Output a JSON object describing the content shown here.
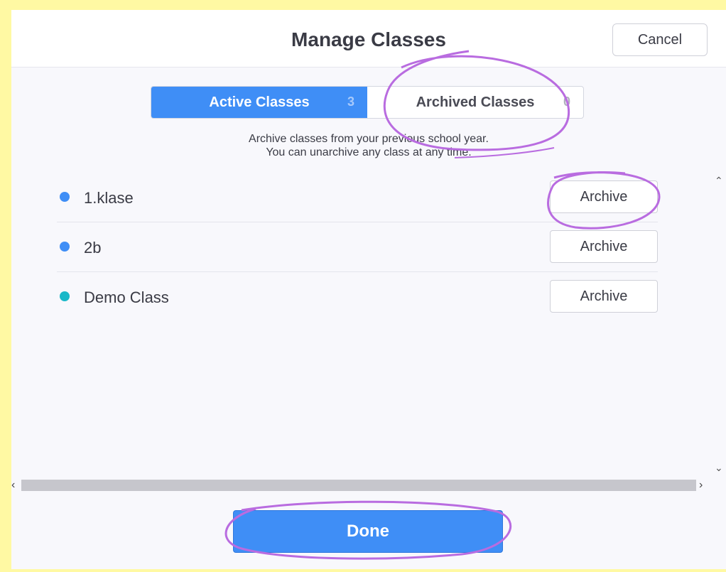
{
  "header": {
    "title": "Manage Classes",
    "cancel_label": "Cancel"
  },
  "tabs": [
    {
      "label": "Active Classes",
      "count": "3",
      "active": true
    },
    {
      "label": "Archived Classes",
      "count": "0",
      "active": false
    }
  ],
  "description": {
    "line1": "Archive classes from your previous school year.",
    "line2": "You can unarchive any class at any time."
  },
  "classes": [
    {
      "name": "1.klase",
      "color": "#3f8ef6",
      "action": "Archive"
    },
    {
      "name": "2b",
      "color": "#3f8ef6",
      "action": "Archive"
    },
    {
      "name": "Demo Class",
      "color": "#1ab8c8",
      "action": "Archive"
    }
  ],
  "scrollbar": {
    "up_icon": "chevron-up-icon",
    "down_icon": "chevron-down-icon",
    "left_icon": "chevron-left-icon",
    "right_icon": "chevron-right-icon"
  },
  "footer": {
    "done_label": "Done"
  },
  "colors": {
    "accent": "#3f8ef6",
    "annotation": "#b96ce0",
    "frame": "#fff9a3"
  }
}
